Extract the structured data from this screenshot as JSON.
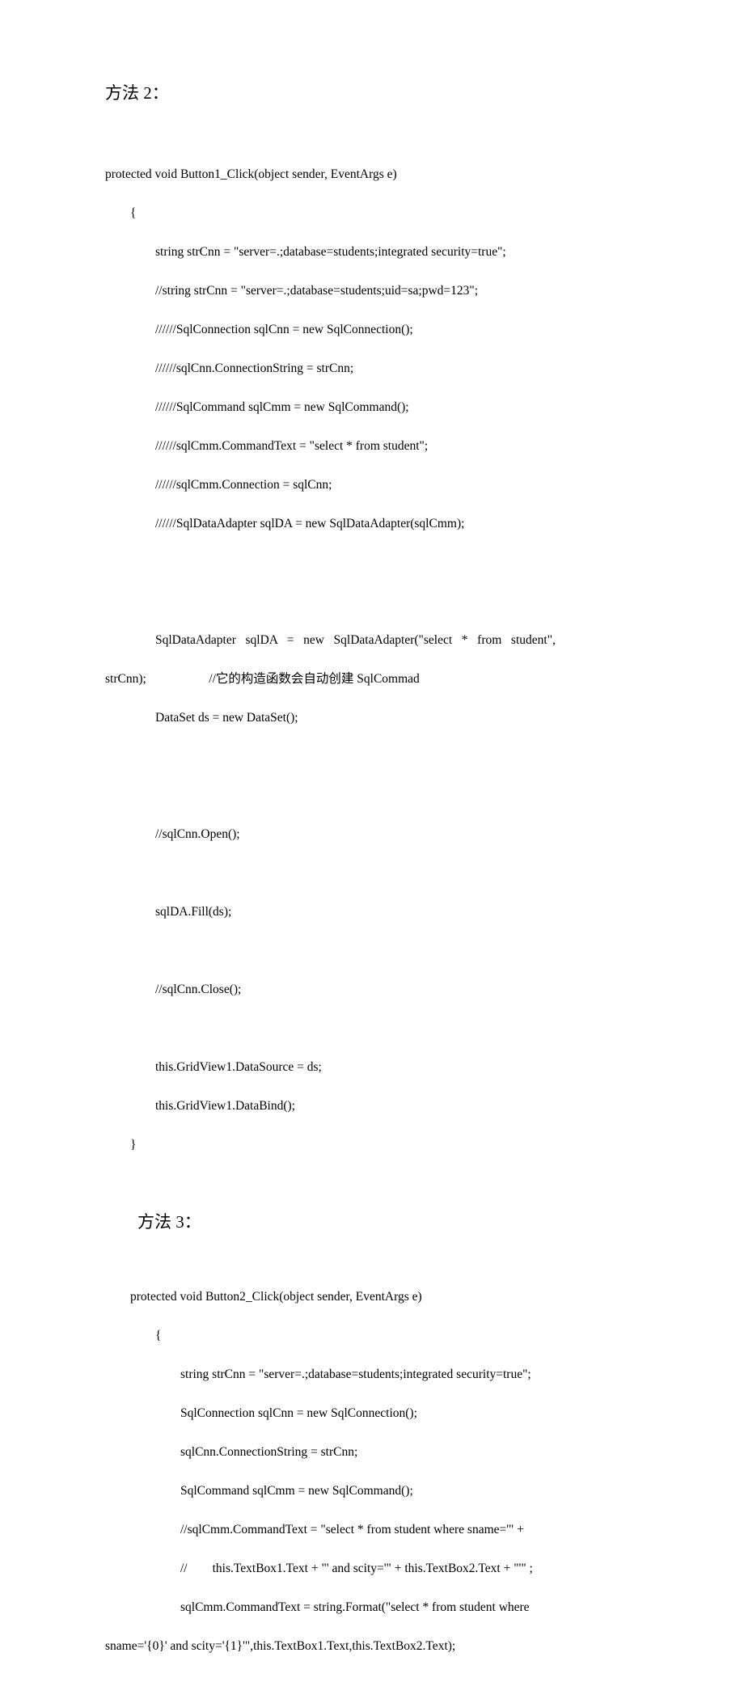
{
  "heading2": "方法 2：",
  "heading3": "方法 3：",
  "block1": {
    "l1": "protected void Button1_Click(object sender, EventArgs e)",
    "l2": "        {",
    "l3": "                string strCnn = \"server=.;database=students;integrated security=true\";",
    "l4": "                //string strCnn = \"server=.;database=students;uid=sa;pwd=123\";",
    "l5": "                //////SqlConnection sqlCnn = new SqlConnection();",
    "l6": "                //////sqlCnn.ConnectionString = strCnn;",
    "l7": "                //////SqlCommand sqlCmm = new SqlCommand();",
    "l8": "                //////sqlCmm.CommandText = \"select * from student\";",
    "l9": "                //////sqlCmm.Connection = sqlCnn;",
    "l10": "                //////SqlDataAdapter sqlDA = new SqlDataAdapter(sqlCmm);",
    "l11a": "                SqlDataAdapter   sqlDA   =   new   SqlDataAdapter(\"select   *   from   student\",",
    "l11b": "strCnn);                    //它的构造函数会自动创建 SqlCommad",
    "l12": "                DataSet ds = new DataSet();",
    "l13": "                //sqlCnn.Open();",
    "l14": "                sqlDA.Fill(ds);",
    "l15": "                //sqlCnn.Close();",
    "l16": "                this.GridView1.DataSource = ds;",
    "l17": "                this.GridView1.DataBind();",
    "l18": "        }"
  },
  "block2": {
    "l1": "        protected void Button2_Click(object sender, EventArgs e)",
    "l2": "                {",
    "l3": "                        string strCnn = \"server=.;database=students;integrated security=true\";",
    "l4": "                        SqlConnection sqlCnn = new SqlConnection();",
    "l5": "                        sqlCnn.ConnectionString = strCnn;",
    "l6": "                        SqlCommand sqlCmm = new SqlCommand();",
    "l7": "                        //sqlCmm.CommandText = \"select * from student where sname='\" +",
    "l8": "                        //        this.TextBox1.Text + \"' and scity='\" + this.TextBox2.Text + \"'\" ;",
    "l9": "                        sqlCmm.CommandText = string.Format(\"select * from student where",
    "l10": "sname='{0}' and scity='{1}'\",this.TextBox1.Text,this.TextBox2.Text);"
  }
}
